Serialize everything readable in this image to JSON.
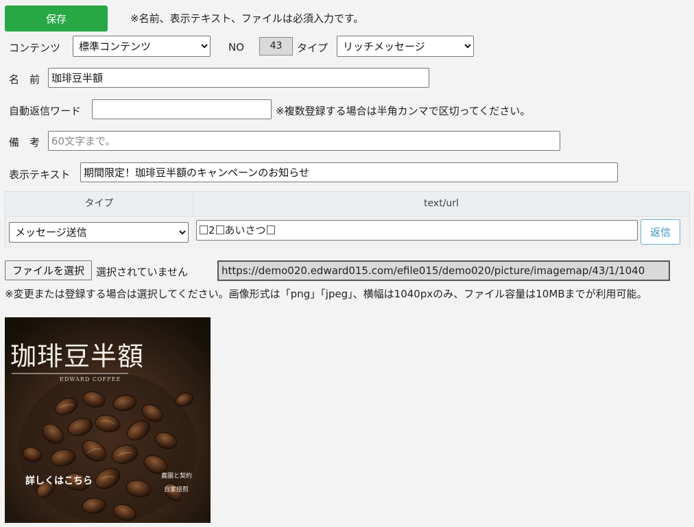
{
  "toolbar": {
    "save_label": "保存",
    "required_note": "※名前、表示テキスト、ファイルは必須入力です。"
  },
  "form": {
    "content_label": "コンテンツ",
    "content_value": "標準コンテンツ",
    "no_label": "NO",
    "no_value": "43",
    "type_label": "タイプ",
    "type_value": "リッチメッセージ",
    "name_label": "名　前",
    "name_value": "珈琲豆半額",
    "autoreply_label": "自動返信ワード",
    "autoreply_value": "",
    "autoreply_note": "※複数登録する場合は半角カンマで区切ってください。",
    "remarks_label": "備　考",
    "remarks_placeholder": "60文字まで。",
    "display_text_label": "表示テキスト",
    "display_text_value": "期間限定！珈琲豆半額のキャンペーンのお知らせ"
  },
  "action_table": {
    "headers": [
      "タイプ",
      "text/url"
    ],
    "row": {
      "type_value": "メッセージ送信",
      "text_parts": [
        "2",
        "あいさつ"
      ],
      "reply_button": "返信"
    }
  },
  "file": {
    "choose_button": "ファイルを選択",
    "status": "選択されていません",
    "url": "https://demo020.edward015.com/efile015/demo020/picture/imagemap/43/1/1040",
    "note": "※変更または登録する場合は選択してください。画像形式は「png」「jpeg」、横幅は1040pxのみ、ファイル容量は10MBまでが利用可能。"
  },
  "preview": {
    "title": "珈琲豆半額",
    "subtitle": "EDWARD COFFEE",
    "cta": "詳しくはこちら",
    "tag1": "農園と契約",
    "tag2": "自家焙煎"
  }
}
